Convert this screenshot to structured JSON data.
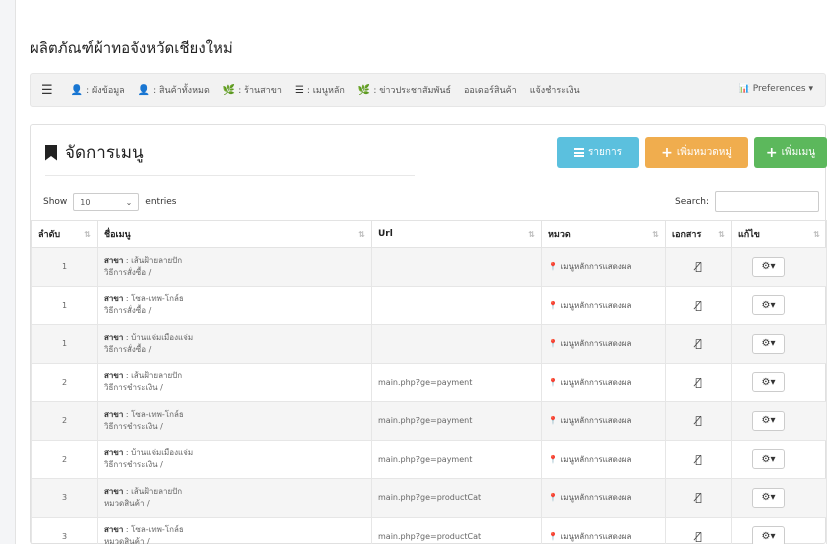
{
  "page_title": "ผลิตภัณฑ์ผ้าทอจังหวัดเชียงใหม่",
  "nav": {
    "items": [
      {
        "icon": "teacher-icon",
        "glyph": "👤",
        "label": ": ผังข้อมูล"
      },
      {
        "icon": "teacher-icon",
        "glyph": "👤",
        "label": ": สินค้าทั้งหมด"
      },
      {
        "icon": "leaf-icon",
        "glyph": "🌿",
        "label": ": ร้านสาขา"
      },
      {
        "icon": "list-icon",
        "glyph": "☰",
        "label": ": เมนูหลัก"
      },
      {
        "icon": "leaf-icon",
        "glyph": "🌿",
        "label": ": ข่าวประชาสัมพันธ์"
      },
      {
        "icon": "",
        "glyph": "",
        "label": "ออเดอร์สินค้า"
      },
      {
        "icon": "",
        "glyph": "",
        "label": "แจ้งชำระเงิน"
      }
    ],
    "preferences": "Preferences ▾"
  },
  "panel": {
    "title": "จัดการเมนู",
    "btn_list": "รายการ",
    "btn_add_category": "เพิ่มหมวดหมู่",
    "btn_add_menu": "เพิ่มเมนู"
  },
  "table_controls": {
    "show": "Show",
    "length_value": "10",
    "entries": "entries",
    "search": "Search:"
  },
  "columns": [
    "ลำดับ",
    "ชื่อเมนู",
    "Url",
    "หมวด",
    "เอกสาร",
    "แก้ไข"
  ],
  "rows": [
    {
      "order": "1",
      "branch": "สาขา",
      "branch_name": " : เส้นฝ้ายลายปัก",
      "sub": "วิธีการสั่งซื้อ /",
      "url": "",
      "category": "เมนูหลักการแสดงผล"
    },
    {
      "order": "1",
      "branch": "สาขา",
      "branch_name": " : โซล-เทพ-โกล์ธ",
      "sub": "วิธีการสั่งซื้อ /",
      "url": "",
      "category": "เมนูหลักการแสดงผล"
    },
    {
      "order": "1",
      "branch": "สาขา",
      "branch_name": " : บ้านแจ่มเมืองแจ่ม",
      "sub": "วิธีการสั่งซื้อ /",
      "url": "",
      "category": "เมนูหลักการแสดงผล"
    },
    {
      "order": "2",
      "branch": "สาขา",
      "branch_name": " : เส้นฝ้ายลายปัก",
      "sub": "วิธีการชำระเงิน /",
      "url": "main.php?ge=payment",
      "category": "เมนูหลักการแสดงผล"
    },
    {
      "order": "2",
      "branch": "สาขา",
      "branch_name": " : โซล-เทพ-โกล์ธ",
      "sub": "วิธีการชำระเงิน /",
      "url": "main.php?ge=payment",
      "category": "เมนูหลักการแสดงผล"
    },
    {
      "order": "2",
      "branch": "สาขา",
      "branch_name": " : บ้านแจ่มเมืองแจ่ม",
      "sub": "วิธีการชำระเงิน /",
      "url": "main.php?ge=payment",
      "category": "เมนูหลักการแสดงผล"
    },
    {
      "order": "3",
      "branch": "สาขา",
      "branch_name": " : เส้นฝ้ายลายปัก",
      "sub": "หมวดสินค้า /",
      "url": "main.php?ge=productCat",
      "category": "เมนูหลักการแสดงผล"
    },
    {
      "order": "3",
      "branch": "สาขา",
      "branch_name": " : โซล-เทพ-โกล์ธ",
      "sub": "หมวดสินค้า /",
      "url": "main.php?ge=productCat",
      "category": "เมนูหลักการแสดงผล"
    }
  ],
  "colors": {
    "info": "#5bc0de",
    "warning": "#f0ad4e",
    "success": "#5cb85c"
  }
}
